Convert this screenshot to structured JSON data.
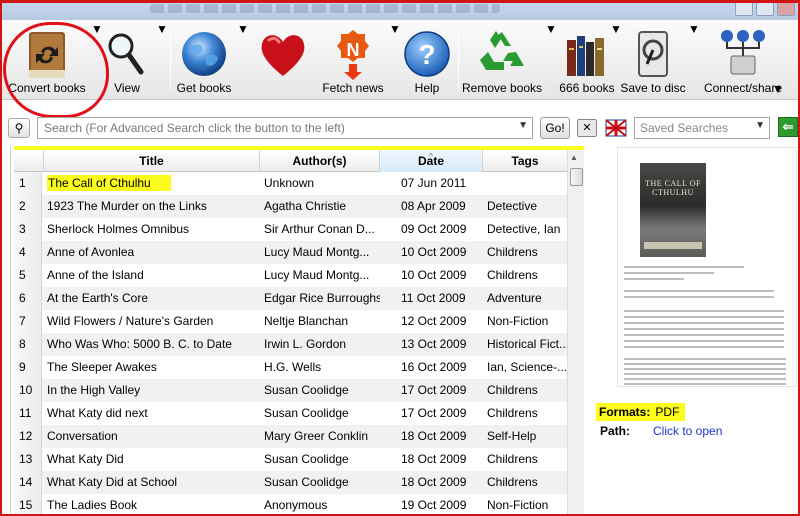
{
  "toolbar": {
    "convert_books": "Convert books",
    "view": "View",
    "get_books": "Get books",
    "fetch_news": "Fetch news",
    "help": "Help",
    "remove_books": "Remove books",
    "library": "666 books",
    "save_to_disc": "Save to disc",
    "connect_share": "Connect/share"
  },
  "search": {
    "placeholder": "Search (For Advanced Search click the button to the left)",
    "go_label": "Go!",
    "saved_searches": "Saved Searches"
  },
  "table": {
    "columns": [
      "Title",
      "Author(s)",
      "Date",
      "Tags"
    ],
    "rows": [
      {
        "n": "1",
        "title": "The Call of Cthulhu",
        "author": "Unknown",
        "date": "07 Jun 2011",
        "tags": ""
      },
      {
        "n": "2",
        "title": "1923 The Murder on the Links",
        "author": "Agatha Christie",
        "date": "08 Apr 2009",
        "tags": "Detective"
      },
      {
        "n": "3",
        "title": "Sherlock Holmes Omnibus",
        "author": "Sir Arthur Conan D...",
        "date": "09 Oct 2009",
        "tags": "Detective, Ian"
      },
      {
        "n": "4",
        "title": "Anne of Avonlea",
        "author": "Lucy Maud Montg...",
        "date": "10 Oct 2009",
        "tags": "Childrens"
      },
      {
        "n": "5",
        "title": "Anne of the Island",
        "author": "Lucy Maud Montg...",
        "date": "10 Oct 2009",
        "tags": "Childrens"
      },
      {
        "n": "6",
        "title": "At the Earth's Core",
        "author": "Edgar Rice Burroughs",
        "date": "11 Oct 2009",
        "tags": "Adventure"
      },
      {
        "n": "7",
        "title": "Wild Flowers / Nature's Garden",
        "author": "Neltje Blanchan",
        "date": "12 Oct 2009",
        "tags": "Non-Fiction"
      },
      {
        "n": "8",
        "title": "Who Was Who: 5000 B. C. to Date",
        "author": "Irwin L. Gordon",
        "date": "13 Oct 2009",
        "tags": "Historical Fict..."
      },
      {
        "n": "9",
        "title": "The Sleeper Awakes",
        "author": "H.G. Wells",
        "date": "16 Oct 2009",
        "tags": "Ian, Science-..."
      },
      {
        "n": "10",
        "title": "In the High Valley",
        "author": "Susan Coolidge",
        "date": "17 Oct 2009",
        "tags": "Childrens"
      },
      {
        "n": "11",
        "title": "What Katy did next",
        "author": "Susan Coolidge",
        "date": "17 Oct 2009",
        "tags": "Childrens"
      },
      {
        "n": "12",
        "title": "Conversation",
        "author": "Mary Greer Conklin",
        "date": "18 Oct 2009",
        "tags": "Self-Help"
      },
      {
        "n": "13",
        "title": "What Katy Did",
        "author": "Susan Coolidge",
        "date": "18 Oct 2009",
        "tags": "Childrens"
      },
      {
        "n": "14",
        "title": "What Katy Did at School",
        "author": "Susan Coolidge",
        "date": "18 Oct 2009",
        "tags": "Childrens"
      },
      {
        "n": "15",
        "title": "The Ladies Book",
        "author": "Anonymous",
        "date": "19 Oct 2009",
        "tags": "Non-Fiction"
      }
    ]
  },
  "details": {
    "cover_title": "THE CALL OF CTHULHU",
    "formats_label": "Formats:",
    "formats_value": "PDF",
    "path_label": "Path:",
    "path_link": "Click to open"
  },
  "colors": {
    "annotation_red": "#e0101a",
    "highlight_yellow": "#fbfb1c",
    "link_blue": "#1a37c8"
  }
}
